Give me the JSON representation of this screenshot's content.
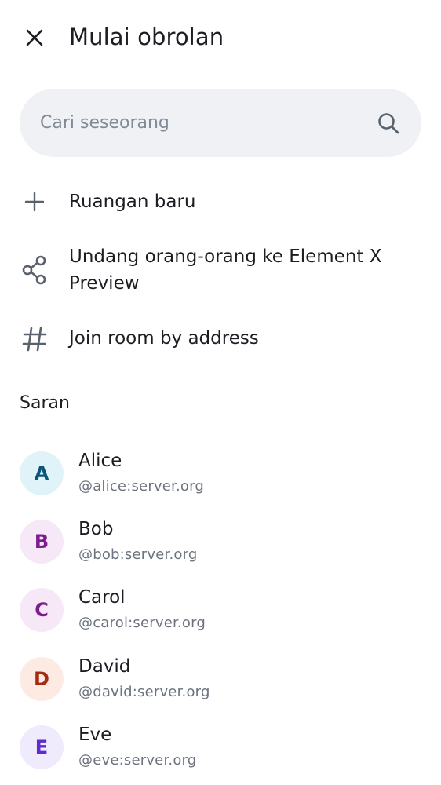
{
  "header": {
    "title": "Mulai obrolan",
    "close_icon": "close-icon"
  },
  "search": {
    "placeholder": "Cari seseorang",
    "value": "",
    "icon": "search-icon"
  },
  "actions": [
    {
      "label": "Ruangan baru",
      "icon": "plus-icon"
    },
    {
      "label": "Undang orang-orang ke Element X Preview",
      "icon": "share-icon"
    },
    {
      "label": "Join room by address",
      "icon": "hash-icon"
    }
  ],
  "suggestions": {
    "title": "Saran",
    "users": [
      {
        "initial": "A",
        "name": "Alice",
        "id": "@alice:server.org",
        "bg": "#e0f3f8",
        "fg": "#0b5578"
      },
      {
        "initial": "B",
        "name": "Bob",
        "id": "@bob:server.org",
        "bg": "#f6e8f7",
        "fg": "#7e1c8e"
      },
      {
        "initial": "C",
        "name": "Carol",
        "id": "@carol:server.org",
        "bg": "#f6e8f7",
        "fg": "#7e1c8e"
      },
      {
        "initial": "D",
        "name": "David",
        "id": "@david:server.org",
        "bg": "#fdeae2",
        "fg": "#a52a10"
      },
      {
        "initial": "E",
        "name": "Eve",
        "id": "@eve:server.org",
        "bg": "#efebfc",
        "fg": "#5d2bd0"
      }
    ]
  },
  "colors": {
    "icon": "#59616c",
    "search_bg": "#eff1f5",
    "text": "#1b1d22",
    "secondary_text": "#6c737e"
  }
}
